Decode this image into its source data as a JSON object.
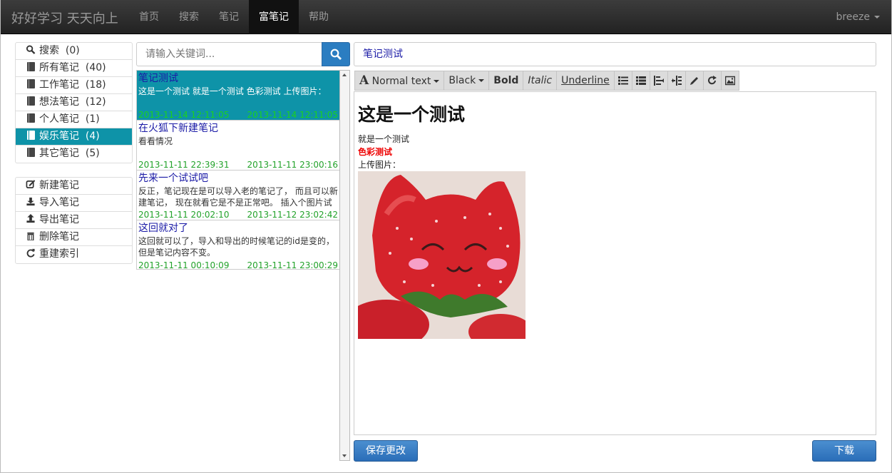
{
  "navbar": {
    "brand": "好好学习 天天向上",
    "items": [
      {
        "label": "首页",
        "active": false
      },
      {
        "label": "搜索",
        "active": false
      },
      {
        "label": "笔记",
        "active": false
      },
      {
        "label": "富笔记",
        "active": true
      },
      {
        "label": "帮助",
        "active": false
      }
    ],
    "user": "breeze"
  },
  "sidebar": {
    "categories": [
      {
        "label": "搜索",
        "count": "(0)",
        "icon": "search-icon"
      },
      {
        "label": "所有笔记",
        "count": "(40)",
        "icon": "book-icon"
      },
      {
        "label": "工作笔记",
        "count": "(18)",
        "icon": "book-icon"
      },
      {
        "label": "想法笔记",
        "count": "(12)",
        "icon": "book-icon"
      },
      {
        "label": "个人笔记",
        "count": "(1)",
        "icon": "book-icon"
      },
      {
        "label": "娱乐笔记",
        "count": "(4)",
        "icon": "book-icon",
        "active": true
      },
      {
        "label": "其它笔记",
        "count": "(5)",
        "icon": "book-icon"
      }
    ],
    "actions": [
      {
        "label": "新建笔记",
        "icon": "edit-icon"
      },
      {
        "label": "导入笔记",
        "icon": "import-icon"
      },
      {
        "label": "导出笔记",
        "icon": "export-icon"
      },
      {
        "label": "删除笔记",
        "icon": "trash-icon"
      },
      {
        "label": "重建索引",
        "icon": "refresh-icon"
      }
    ]
  },
  "search": {
    "placeholder": "请输入关键词..."
  },
  "notes": [
    {
      "title": "笔记测试",
      "summary": "这是一个测试 就是一个测试 色彩测试 上传图片：",
      "created": "2013-11-14 12:11:05",
      "modified": "2013-11-14 12:11:05",
      "selected": true
    },
    {
      "title": "在火狐下新建笔记",
      "summary": "看看情况",
      "created": "2013-11-11 22:39:31",
      "modified": "2013-11-11 23:00:16"
    },
    {
      "title": "先来一个试试吧",
      "summary": "反正，笔记现在是可以导入老的笔记了， 而且可以新建笔记， 现在就看它是不是正常吧。 插入个图片试",
      "created": "2013-11-11 20:02:10",
      "modified": "2013-11-12 23:02:42"
    },
    {
      "title": "这回就对了",
      "summary": "这回就可以了，导入和导出的时候笔记的id是变的，但是笔记内容不变。",
      "created": "2013-11-11 00:10:09",
      "modified": "2013-11-11 23:00:29"
    }
  ],
  "editor": {
    "title": "笔记测试",
    "toolbar": {
      "style": "Normal text",
      "color": "Black",
      "bold": "Bold",
      "italic": "Italic",
      "underline": "Underline",
      "icons": [
        "unordered-list-icon",
        "ordered-list-icon",
        "outdent-icon",
        "indent-icon",
        "pencil-icon",
        "redo-icon",
        "image-icon"
      ]
    },
    "content": {
      "heading": "这是一个测试",
      "line1": "就是一个测试",
      "line2": "色彩测试",
      "line3": "上传图片："
    }
  },
  "buttons": {
    "save": "保存更改",
    "download": "下载"
  },
  "colors": {
    "accent": "#0e93a8",
    "primary": "#2b7dc1",
    "date": "#22a22a",
    "link": "#1a1aa6"
  }
}
